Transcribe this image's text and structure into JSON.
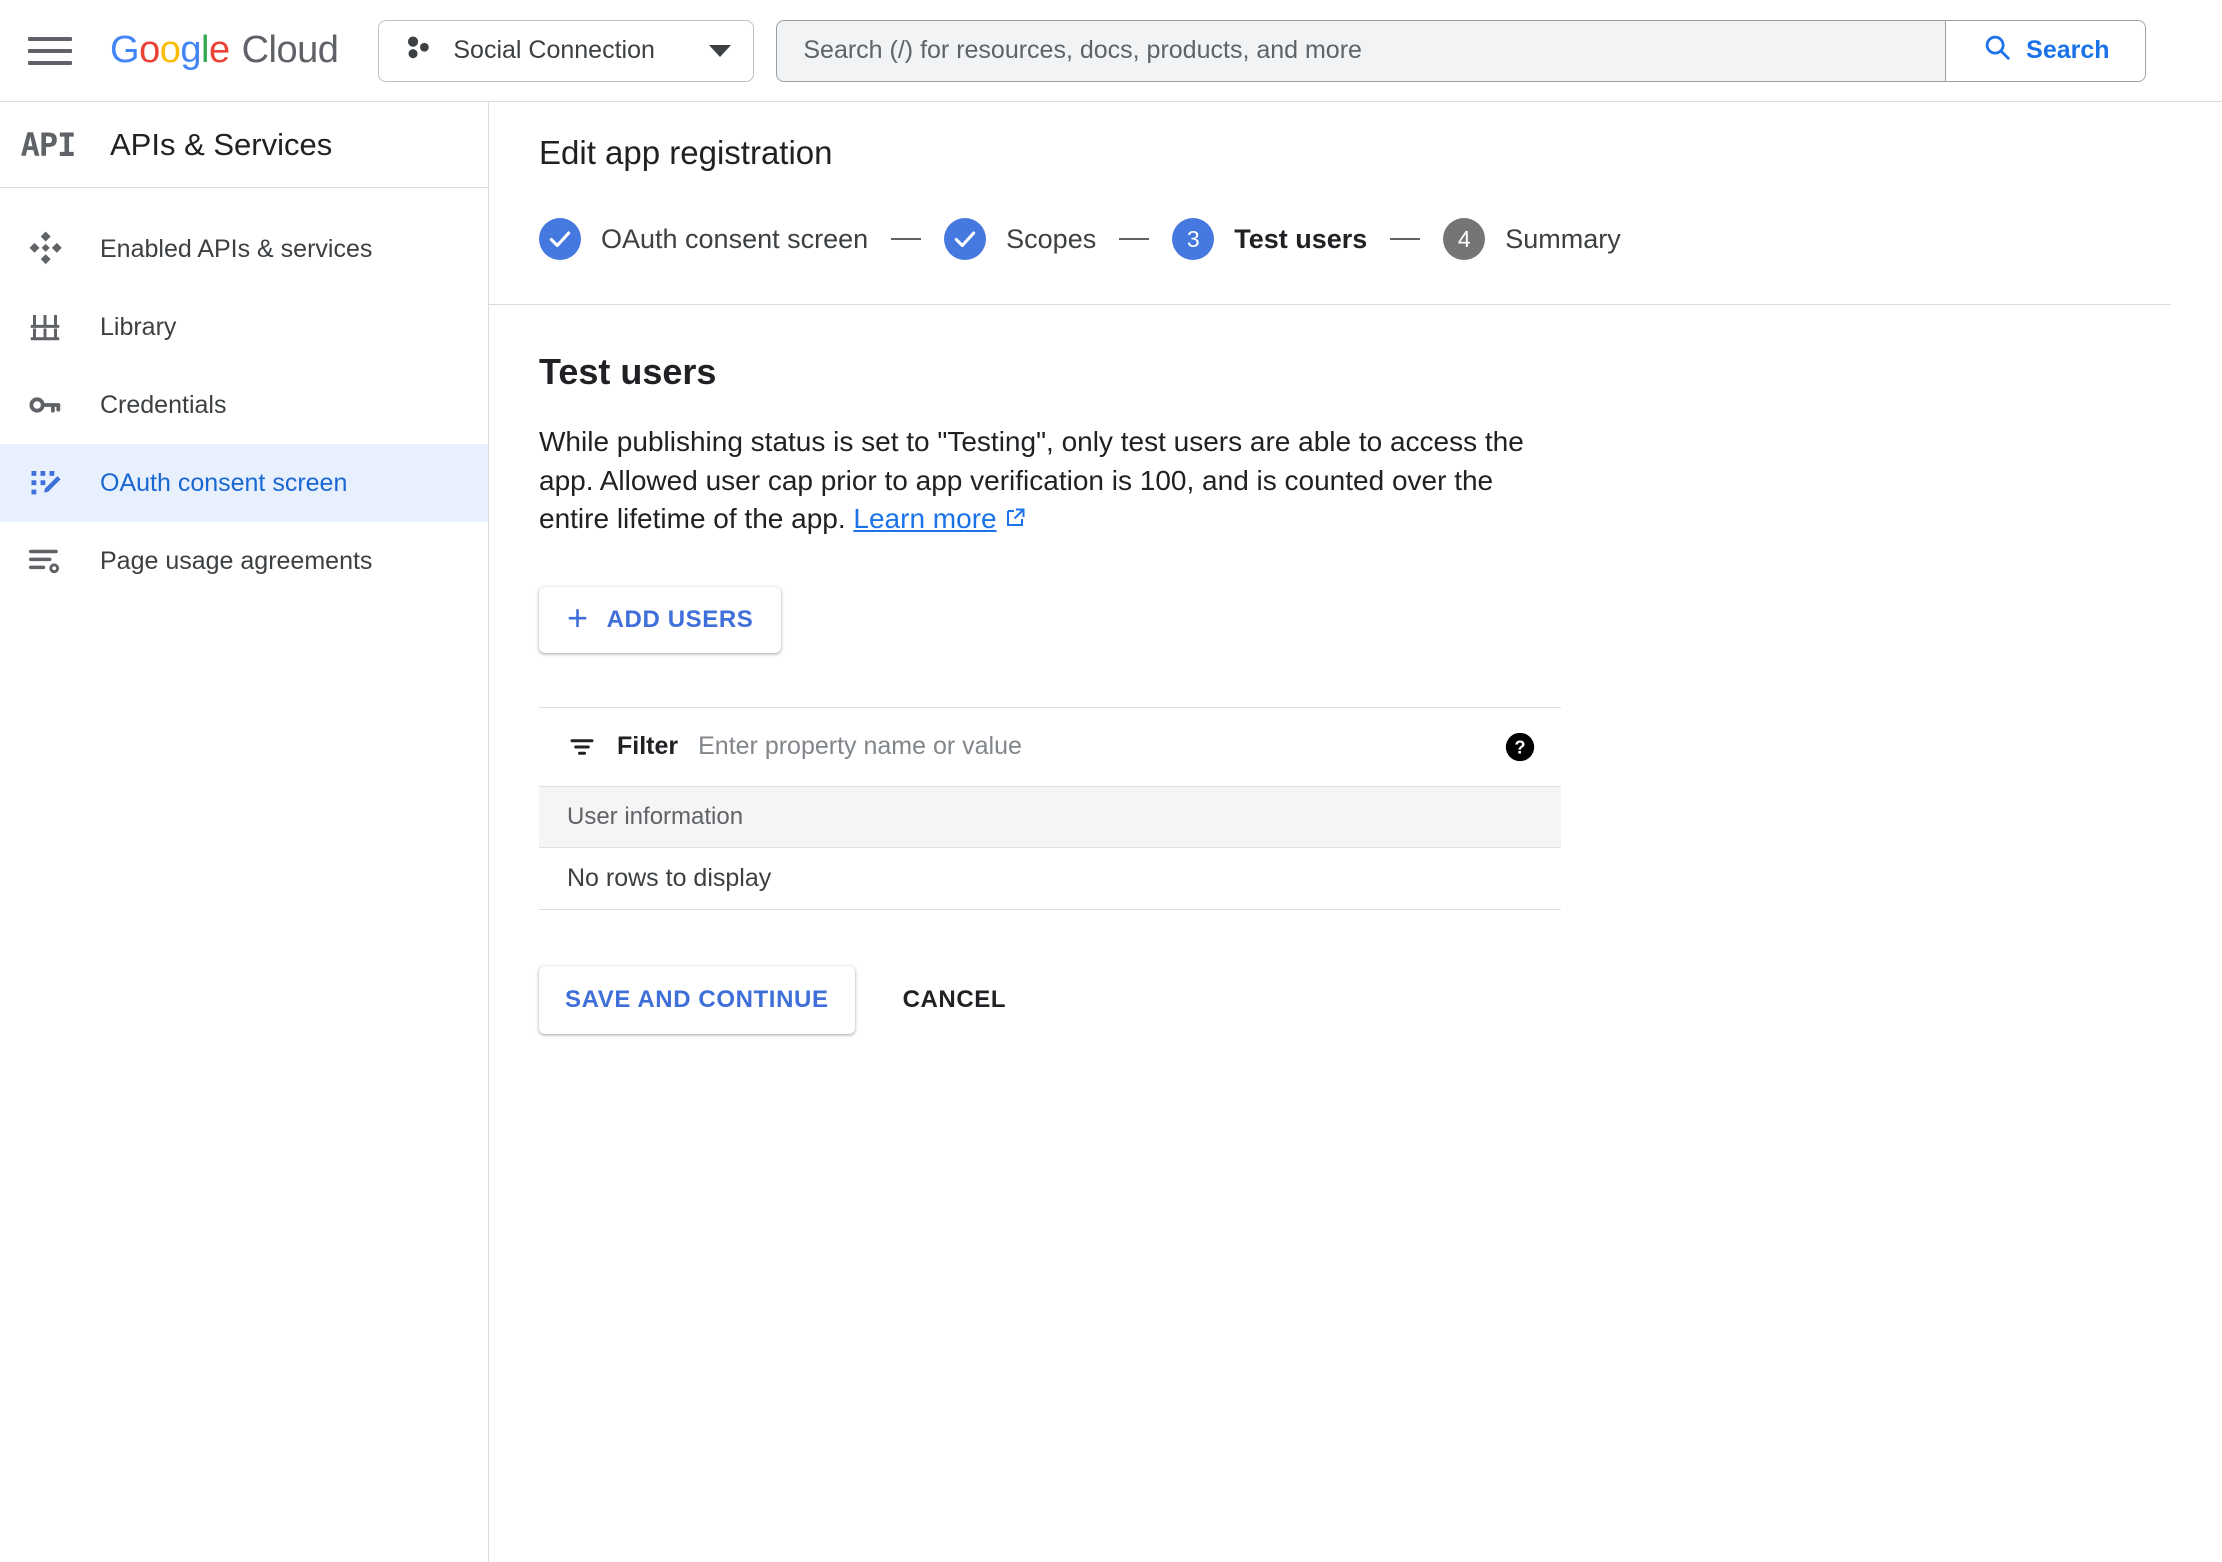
{
  "topbar": {
    "menu_icon": "hamburger-menu-icon",
    "brand": {
      "google": "Google",
      "cloud": "Cloud"
    },
    "project_selector": {
      "label": "Social Connection",
      "icon": "project-hexagons-icon",
      "caret": "chevron-down-icon"
    },
    "search": {
      "placeholder": "Search (/) for resources, docs, products, and more",
      "value": "",
      "button_label": "Search",
      "button_icon": "search-icon"
    }
  },
  "sidebar": {
    "badge": "API",
    "title": "APIs & Services",
    "items": [
      {
        "label": "Enabled APIs & services",
        "icon": "diamond-cluster-icon",
        "active": false
      },
      {
        "label": "Library",
        "icon": "library-columns-icon",
        "active": false
      },
      {
        "label": "Credentials",
        "icon": "key-icon",
        "active": false
      },
      {
        "label": "OAuth consent screen",
        "icon": "consent-screen-pencil-icon",
        "active": true
      },
      {
        "label": "Page usage agreements",
        "icon": "agreements-gear-icon",
        "active": false
      }
    ]
  },
  "main": {
    "page_title": "Edit app registration",
    "stepper": [
      {
        "num": "1",
        "label": "OAuth consent screen",
        "state": "done"
      },
      {
        "num": "2",
        "label": "Scopes",
        "state": "done"
      },
      {
        "num": "3",
        "label": "Test users",
        "state": "current"
      },
      {
        "num": "4",
        "label": "Summary",
        "state": "todo"
      }
    ],
    "section_heading": "Test users",
    "description_text": "While publishing status is set to \"Testing\", only test users are able to access the app. Allowed user cap prior to app verification is 100, and is counted over the entire lifetime of the app. ",
    "learn_more_label": "Learn more",
    "learn_more_icon": "open-in-new-icon",
    "add_users_label": "ADD USERS",
    "add_users_icon": "plus-icon",
    "filter": {
      "icon": "filter-icon",
      "label": "Filter",
      "placeholder": "Enter property name or value",
      "value": "",
      "help_icon": "help-circle-icon"
    },
    "table": {
      "columns": [
        "User information"
      ],
      "rows": [],
      "empty_text": "No rows to display"
    },
    "save_label": "SAVE AND CONTINUE",
    "cancel_label": "CANCEL"
  },
  "colors": {
    "accent_blue": "#1a73e8",
    "step_blue": "#4579e0",
    "step_gray": "#757575",
    "active_nav_bg": "#e8f0fe",
    "active_nav_fg": "#1967d2",
    "border": "#dadce0",
    "table_head_bg": "#f5f5f5",
    "button_blue": "#3f6fd8"
  }
}
